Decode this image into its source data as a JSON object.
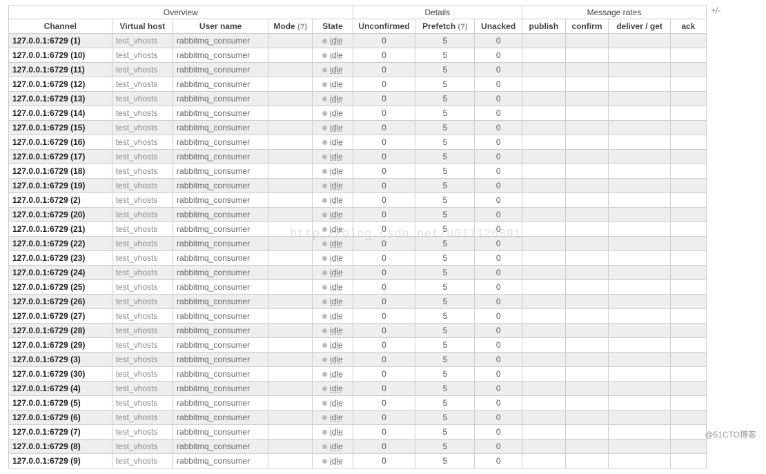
{
  "headers_group": {
    "overview": "Overview",
    "details": "Details",
    "rates": "Message rates"
  },
  "headers": {
    "channel": "Channel",
    "vhost": "Virtual host",
    "user": "User name",
    "mode": "Mode",
    "state": "State",
    "unconfirmed": "Unconfirmed",
    "prefetch": "Prefetch",
    "unacked": "Unacked",
    "publish": "publish",
    "confirm": "confirm",
    "deliver_get": "deliver / get",
    "ack": "ack",
    "help": "(?)"
  },
  "plusminus": "+/-",
  "state_label": "idle",
  "vhost_value": "test_vhosts",
  "user_value": "rabbitmq_consumer",
  "rows": [
    {
      "ch": "127.0.0.1:6729 (1)",
      "unconf": "0",
      "pref": "5",
      "unack": "0"
    },
    {
      "ch": "127.0.0.1:6729 (10)",
      "unconf": "0",
      "pref": "5",
      "unack": "0"
    },
    {
      "ch": "127.0.0.1:6729 (11)",
      "unconf": "0",
      "pref": "5",
      "unack": "0"
    },
    {
      "ch": "127.0.0.1:6729 (12)",
      "unconf": "0",
      "pref": "5",
      "unack": "0"
    },
    {
      "ch": "127.0.0.1:6729 (13)",
      "unconf": "0",
      "pref": "5",
      "unack": "0"
    },
    {
      "ch": "127.0.0.1:6729 (14)",
      "unconf": "0",
      "pref": "5",
      "unack": "0"
    },
    {
      "ch": "127.0.0.1:6729 (15)",
      "unconf": "0",
      "pref": "5",
      "unack": "0"
    },
    {
      "ch": "127.0.0.1:6729 (16)",
      "unconf": "0",
      "pref": "5",
      "unack": "0"
    },
    {
      "ch": "127.0.0.1:6729 (17)",
      "unconf": "0",
      "pref": "5",
      "unack": "0"
    },
    {
      "ch": "127.0.0.1:6729 (18)",
      "unconf": "0",
      "pref": "5",
      "unack": "0"
    },
    {
      "ch": "127.0.0.1:6729 (19)",
      "unconf": "0",
      "pref": "5",
      "unack": "0"
    },
    {
      "ch": "127.0.0.1:6729 (2)",
      "unconf": "0",
      "pref": "5",
      "unack": "0"
    },
    {
      "ch": "127.0.0.1:6729 (20)",
      "unconf": "0",
      "pref": "5",
      "unack": "0"
    },
    {
      "ch": "127.0.0.1:6729 (21)",
      "unconf": "0",
      "pref": "5",
      "unack": "0"
    },
    {
      "ch": "127.0.0.1:6729 (22)",
      "unconf": "0",
      "pref": "5",
      "unack": "0"
    },
    {
      "ch": "127.0.0.1:6729 (23)",
      "unconf": "0",
      "pref": "5",
      "unack": "0"
    },
    {
      "ch": "127.0.0.1:6729 (24)",
      "unconf": "0",
      "pref": "5",
      "unack": "0"
    },
    {
      "ch": "127.0.0.1:6729 (25)",
      "unconf": "0",
      "pref": "5",
      "unack": "0"
    },
    {
      "ch": "127.0.0.1:6729 (26)",
      "unconf": "0",
      "pref": "5",
      "unack": "0"
    },
    {
      "ch": "127.0.0.1:6729 (27)",
      "unconf": "0",
      "pref": "5",
      "unack": "0"
    },
    {
      "ch": "127.0.0.1:6729 (28)",
      "unconf": "0",
      "pref": "5",
      "unack": "0"
    },
    {
      "ch": "127.0.0.1:6729 (29)",
      "unconf": "0",
      "pref": "5",
      "unack": "0"
    },
    {
      "ch": "127.0.0.1:6729 (3)",
      "unconf": "0",
      "pref": "5",
      "unack": "0"
    },
    {
      "ch": "127.0.0.1:6729 (30)",
      "unconf": "0",
      "pref": "5",
      "unack": "0"
    },
    {
      "ch": "127.0.0.1:6729 (4)",
      "unconf": "0",
      "pref": "5",
      "unack": "0"
    },
    {
      "ch": "127.0.0.1:6729 (5)",
      "unconf": "0",
      "pref": "5",
      "unack": "0"
    },
    {
      "ch": "127.0.0.1:6729 (6)",
      "unconf": "0",
      "pref": "5",
      "unack": "0"
    },
    {
      "ch": "127.0.0.1:6729 (7)",
      "unconf": "0",
      "pref": "5",
      "unack": "0"
    },
    {
      "ch": "127.0.0.1:6729 (8)",
      "unconf": "0",
      "pref": "5",
      "unack": "0"
    },
    {
      "ch": "127.0.0.1:6729 (9)",
      "unconf": "0",
      "pref": "5",
      "unack": "0"
    }
  ],
  "watermark": "http://blog.csdn.net/u011126891",
  "footer": "@51CTO博客"
}
